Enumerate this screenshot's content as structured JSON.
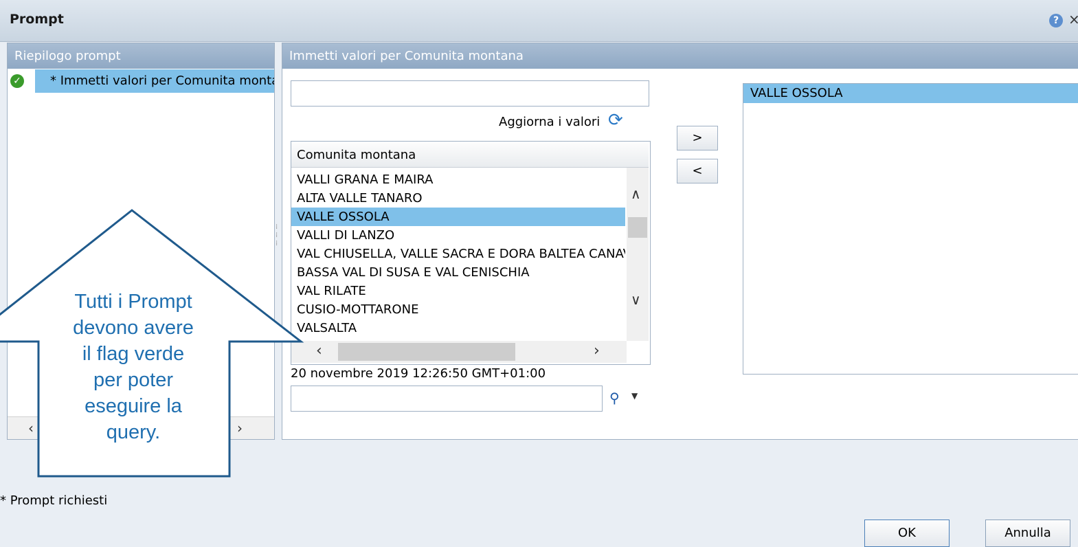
{
  "window": {
    "title": "Prompt",
    "help_icon": "?",
    "close_icon": "×"
  },
  "summary_panel": {
    "header": "Riepilogo prompt",
    "items": [
      {
        "label": "* Immetti valori per Comunita montana",
        "status": "complete"
      }
    ],
    "scroll_left": "‹",
    "scroll_right": "›"
  },
  "values_panel": {
    "header": "Immetti valori per Comunita montana",
    "filter_value": "",
    "refresh_label": "Aggiorna i valori",
    "list": {
      "column_header": "Comunita montana",
      "items": [
        "VALLI GRANA E MAIRA",
        "ALTA VALLE TANARO",
        "VALLE OSSOLA",
        "VALLI DI LANZO",
        "VAL CHIUSELLA, VALLE SACRA E DORA BALTEA CANAVESANA",
        "BASSA VAL DI SUSA E VAL CENISCHIA",
        "VAL RILATE",
        "CUSIO-MOTTARONE",
        "VALSALTA"
      ],
      "selected_index": 2
    },
    "timestamp": "20 novembre 2019 12:26:50 GMT+01:00",
    "search_value": "",
    "add_button": ">",
    "remove_button": "<",
    "selected_values": [
      "VALLE OSSOLA"
    ]
  },
  "footer": {
    "required_note": "* Prompt richiesti",
    "ok_label": "OK",
    "cancel_label": "Annulla"
  },
  "callout": {
    "lines": [
      "Tutti i Prompt",
      "devono avere",
      "il flag verde",
      "per poter",
      "eseguire la",
      "query."
    ]
  },
  "colors": {
    "selection": "#7fc0e9",
    "header": "#8fa8c4",
    "callout": "#1f5a8c",
    "check": "#3a9b2b"
  }
}
